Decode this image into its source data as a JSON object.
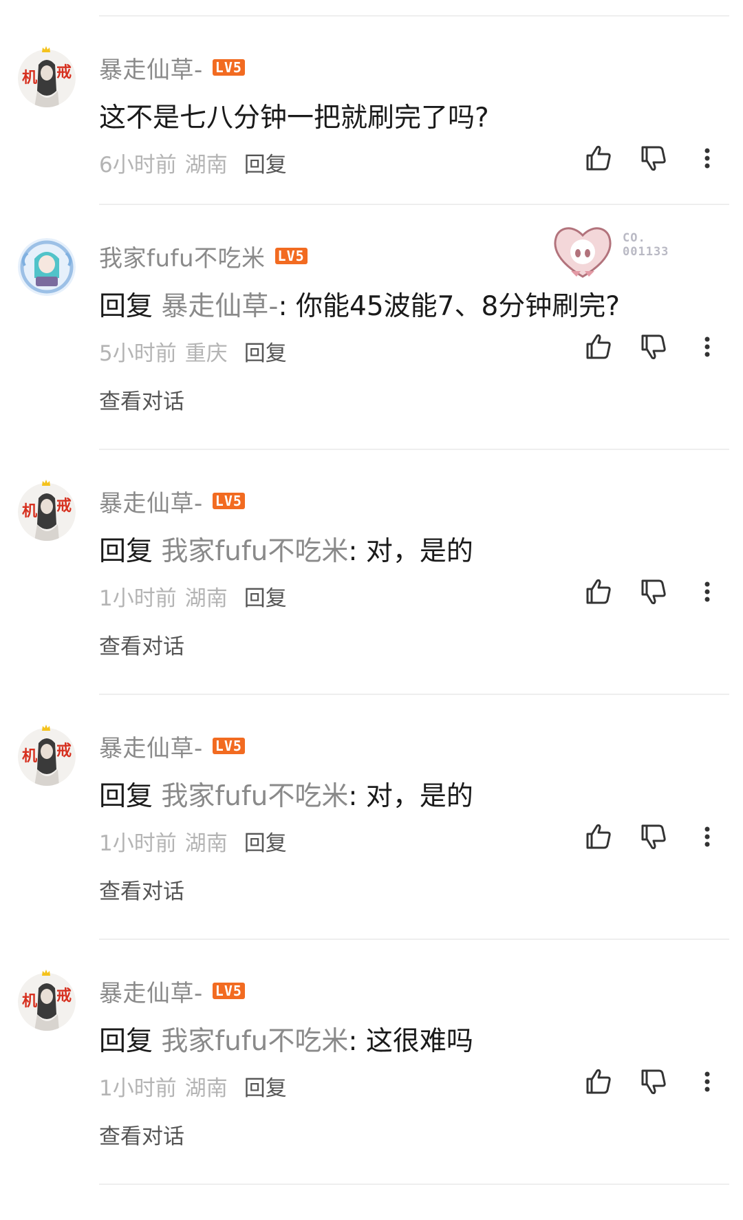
{
  "comments": [
    {
      "username": "暴走仙草-",
      "level": "LV5",
      "reply_prefix": "",
      "reply_target": "",
      "text": "这不是七八分钟一把就刷完了吗?",
      "time": "6小时前",
      "location": "湖南",
      "reply_label": "回复",
      "view_conversation": ""
    },
    {
      "username": "我家fufu不吃米",
      "level": "LV5",
      "reply_prefix": "回复",
      "reply_target": "暴走仙草-",
      "text": ": 你能45波能7、8分钟刷完?",
      "time": "5小时前",
      "location": "重庆",
      "reply_label": "回复",
      "view_conversation": "查看对话",
      "badge_code_line1": "CO.",
      "badge_code_line2": "001133"
    },
    {
      "username": "暴走仙草-",
      "level": "LV5",
      "reply_prefix": "回复",
      "reply_target": "我家fufu不吃米",
      "text": ": 对，是的",
      "time": "1小时前",
      "location": "湖南",
      "reply_label": "回复",
      "view_conversation": "查看对话"
    },
    {
      "username": "暴走仙草-",
      "level": "LV5",
      "reply_prefix": "回复",
      "reply_target": "我家fufu不吃米",
      "text": ": 对，是的",
      "time": "1小时前",
      "location": "湖南",
      "reply_label": "回复",
      "view_conversation": "查看对话"
    },
    {
      "username": "暴走仙草-",
      "level": "LV5",
      "reply_prefix": "回复",
      "reply_target": "我家fufu不吃米",
      "text": ": 这很难吗",
      "time": "1小时前",
      "location": "湖南",
      "reply_label": "回复",
      "view_conversation": "查看对话"
    }
  ],
  "icons": {
    "like": "thumbs-up-icon",
    "dislike": "thumbs-down-icon",
    "more": "more-vertical-icon"
  },
  "colors": {
    "level_badge": "#f26b21",
    "username": "#8a8a8a",
    "text": "#1a1a1a",
    "meta": "#b4b4b4"
  }
}
